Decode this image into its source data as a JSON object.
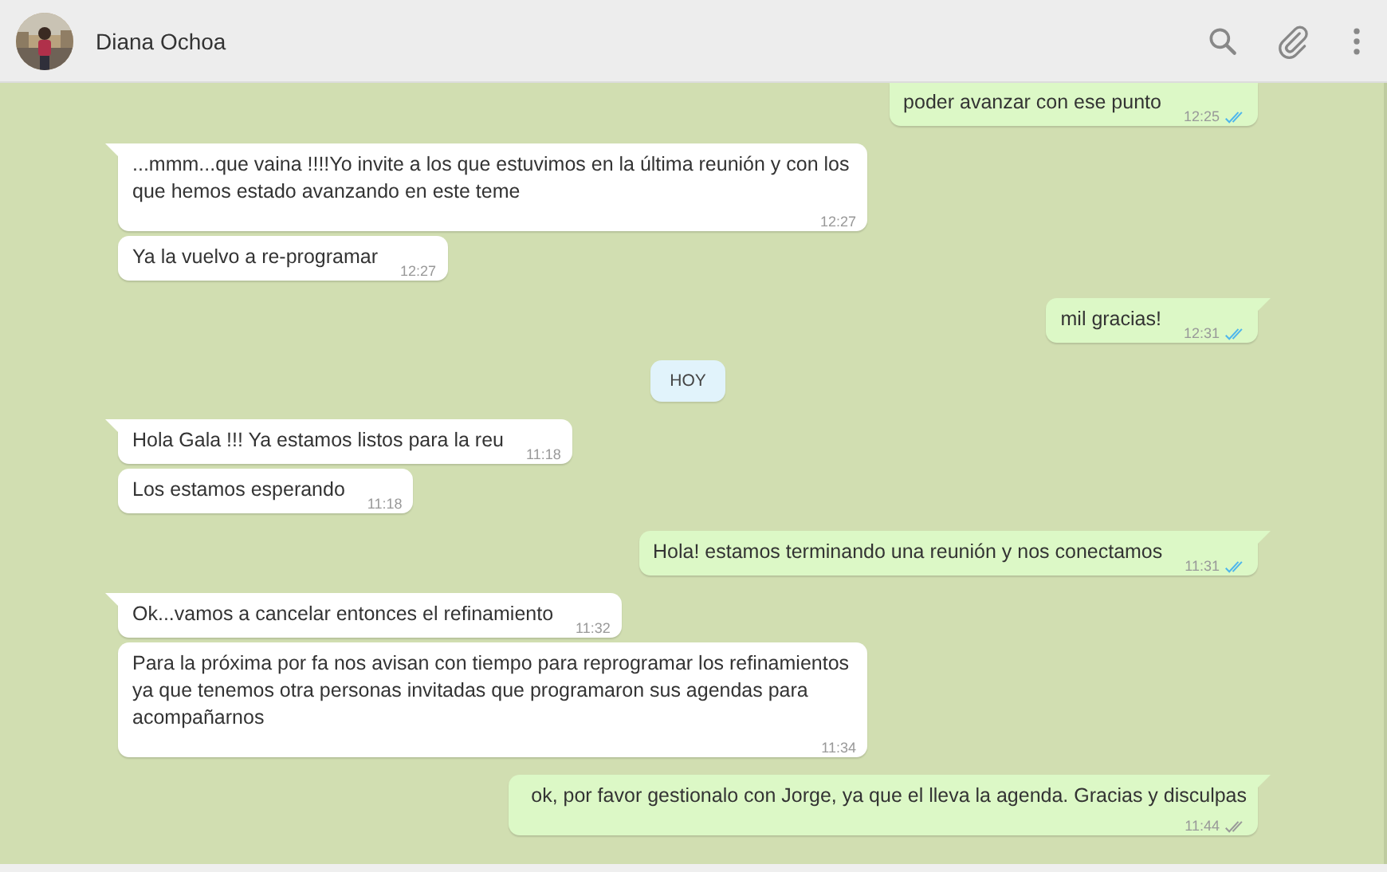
{
  "header": {
    "contact_name": "Diana Ochoa"
  },
  "messages": [
    {
      "kind": "out",
      "text": "poder avanzar con ese punto",
      "time": "12:25",
      "read": true,
      "tail": false,
      "clipped": true
    },
    {
      "kind": "in",
      "text": "...mmm...que vaina !!!!Yo invite a los que estuvimos en la última reunión y con los que hemos estado avanzando en este teme",
      "time": "12:27",
      "tail": true
    },
    {
      "kind": "in",
      "text": "Ya la vuelvo a re-programar",
      "time": "12:27",
      "tail": false
    },
    {
      "kind": "out",
      "text": "mil gracias!",
      "time": "12:31",
      "read": true,
      "tail": true
    },
    {
      "kind": "date",
      "text": "HOY"
    },
    {
      "kind": "in",
      "text": "Hola Gala !!! Ya estamos listos para la reu",
      "time": "11:18",
      "tail": true
    },
    {
      "kind": "in",
      "text": "Los estamos esperando",
      "time": "11:18",
      "tail": false
    },
    {
      "kind": "out",
      "text": "Hola! estamos terminando una reunión y nos conectamos",
      "time": "11:31",
      "read": true,
      "tail": true
    },
    {
      "kind": "in",
      "text": "Ok...vamos a cancelar entonces el refinamiento",
      "time": "11:32",
      "tail": true
    },
    {
      "kind": "in",
      "text": "Para la próxima por fa nos avisan con tiempo para reprogramar los refinamientos ya que tenemos otra personas invitadas que programaron sus agendas para acompañarnos",
      "time": "11:34",
      "tail": false
    },
    {
      "kind": "out",
      "text": "ok, por favor gestionalo con Jorge, ya que el lleva la agenda. Gracias y disculpas",
      "time": "11:44",
      "read": false,
      "tail": true
    }
  ]
}
